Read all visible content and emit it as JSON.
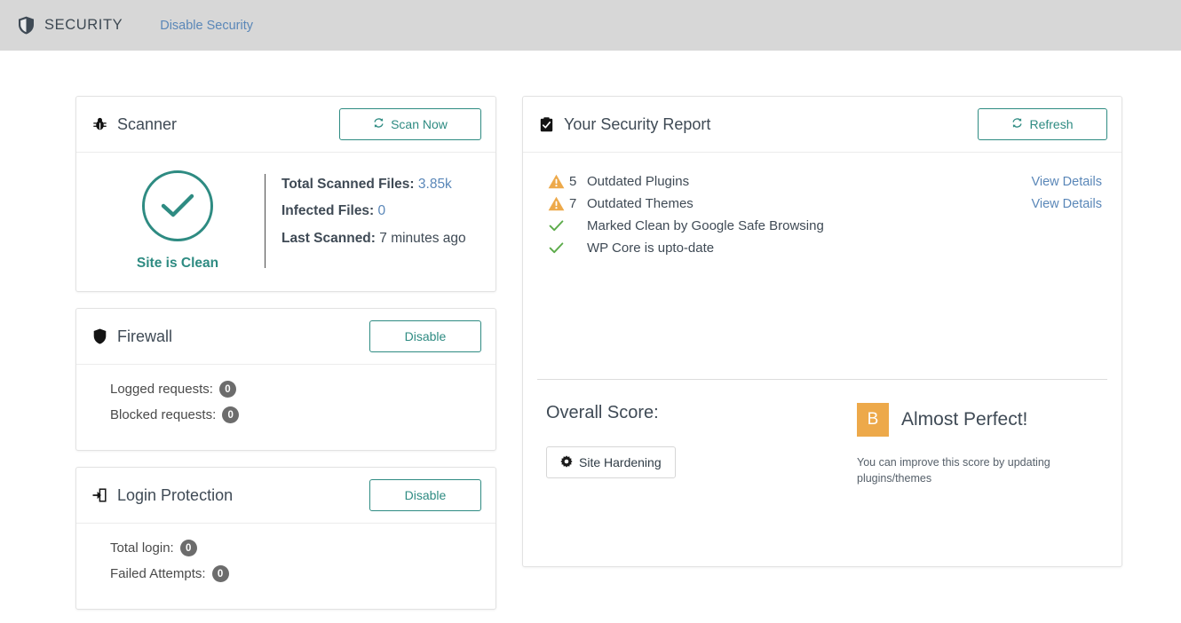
{
  "topbar": {
    "icon": "shield-icon",
    "title": "SECURITY",
    "link_label": "Disable Security"
  },
  "scanner": {
    "icon": "bug-icon",
    "title": "Scanner",
    "scan_button": {
      "label": "Scan Now",
      "icon": "refresh-icon"
    },
    "status_icon": "check-circle-icon",
    "status_label": "Site is Clean",
    "stats": [
      {
        "label": "Total Scanned Files:",
        "value": "3.85k",
        "value_style": "link"
      },
      {
        "label": "Infected Files:",
        "value": "0",
        "value_style": "link"
      },
      {
        "label": "Last Scanned:",
        "value": "7 minutes ago",
        "value_style": "plain"
      }
    ]
  },
  "firewall": {
    "icon": "shield-solid-icon",
    "title": "Firewall",
    "toggle_button": {
      "label": "Disable"
    },
    "counters": [
      {
        "label": "Logged requests:",
        "value": "0"
      },
      {
        "label": "Blocked requests:",
        "value": "0"
      }
    ]
  },
  "login_protection": {
    "icon": "sign-in-icon",
    "title": "Login Protection",
    "toggle_button": {
      "label": "Disable"
    },
    "counters": [
      {
        "label": "Total login:",
        "value": "0"
      },
      {
        "label": "Failed Attempts:",
        "value": "0"
      }
    ]
  },
  "security_report": {
    "icon": "clipboard-check-icon",
    "title": "Your Security Report",
    "refresh_button": {
      "label": "Refresh",
      "icon": "refresh-icon"
    },
    "items": [
      {
        "status": "warning",
        "count": "5",
        "text": "Outdated Plugins",
        "link_label": "View Details"
      },
      {
        "status": "warning",
        "count": "7",
        "text": "Outdated Themes",
        "link_label": "View Details"
      },
      {
        "status": "ok",
        "count": "",
        "text": "Marked Clean by Google Safe Browsing",
        "link_label": ""
      },
      {
        "status": "ok",
        "count": "",
        "text": "WP Core is upto-date",
        "link_label": ""
      }
    ],
    "overall_score": {
      "heading": "Overall Score:",
      "hardening_button": {
        "label": "Site Hardening",
        "icon": "gear-icon"
      },
      "grade": "B",
      "grade_text": "Almost Perfect!",
      "note": "You can improve this score by updating plugins/themes"
    }
  },
  "colors": {
    "teal": "#2e8b82",
    "link_blue": "#5a87b8",
    "warning_orange": "#eda94a",
    "ok_green": "#5cab4a",
    "badge_grey": "#6c6c6c",
    "header_grey": "#d7d7d7",
    "text_dark": "#3f4a55"
  }
}
